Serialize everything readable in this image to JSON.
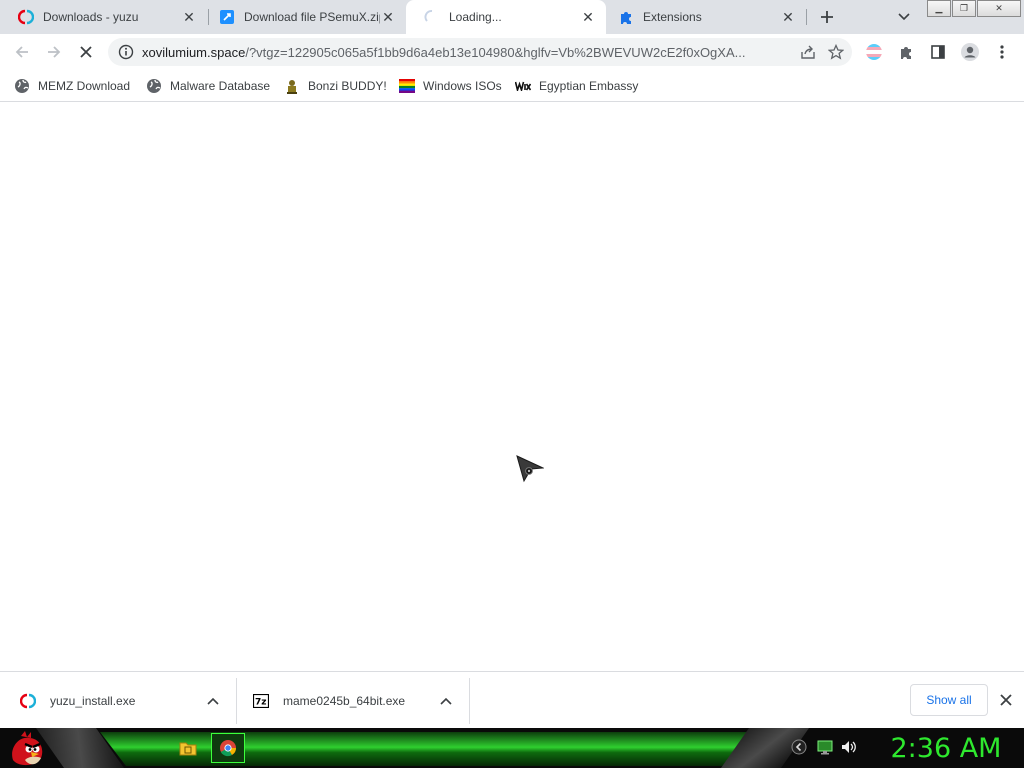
{
  "tabs": [
    {
      "title": "Downloads - yuzu",
      "icon": "yuzu-icon"
    },
    {
      "title": "Download file PSemuX.zip",
      "icon": "mediafire-icon"
    },
    {
      "title": "Loading...",
      "icon": "loading-spinner-icon",
      "active": true
    },
    {
      "title": "Extensions",
      "icon": "puzzle-piece-icon"
    }
  ],
  "toolbar": {
    "url_domain": "xovilumium.space",
    "url_path": "/?vtgz=122905c065a5f1bb9d6a4eb13e104980&hglfv=Vb%2BWEVUW2cE2f0xOgXA..."
  },
  "bookmarks": [
    {
      "label": "MEMZ Download",
      "icon": "globe-icon"
    },
    {
      "label": "Malware Database",
      "icon": "globe-icon"
    },
    {
      "label": "Bonzi BUDDY!",
      "icon": "bonzi-icon"
    },
    {
      "label": "Windows ISOs",
      "icon": "rainbow-flag-icon"
    },
    {
      "label": "Egyptian Embassy",
      "icon": "wix-icon"
    }
  ],
  "downloads": [
    {
      "name": "yuzu_install.exe",
      "icon": "yuzu-icon"
    },
    {
      "name": "mame0245b_64bit.exe",
      "icon": "7zip-icon"
    }
  ],
  "shelf": {
    "show_all": "Show all"
  },
  "taskbar": {
    "clock": "2:36 AM",
    "accent": "#2ee82e"
  }
}
